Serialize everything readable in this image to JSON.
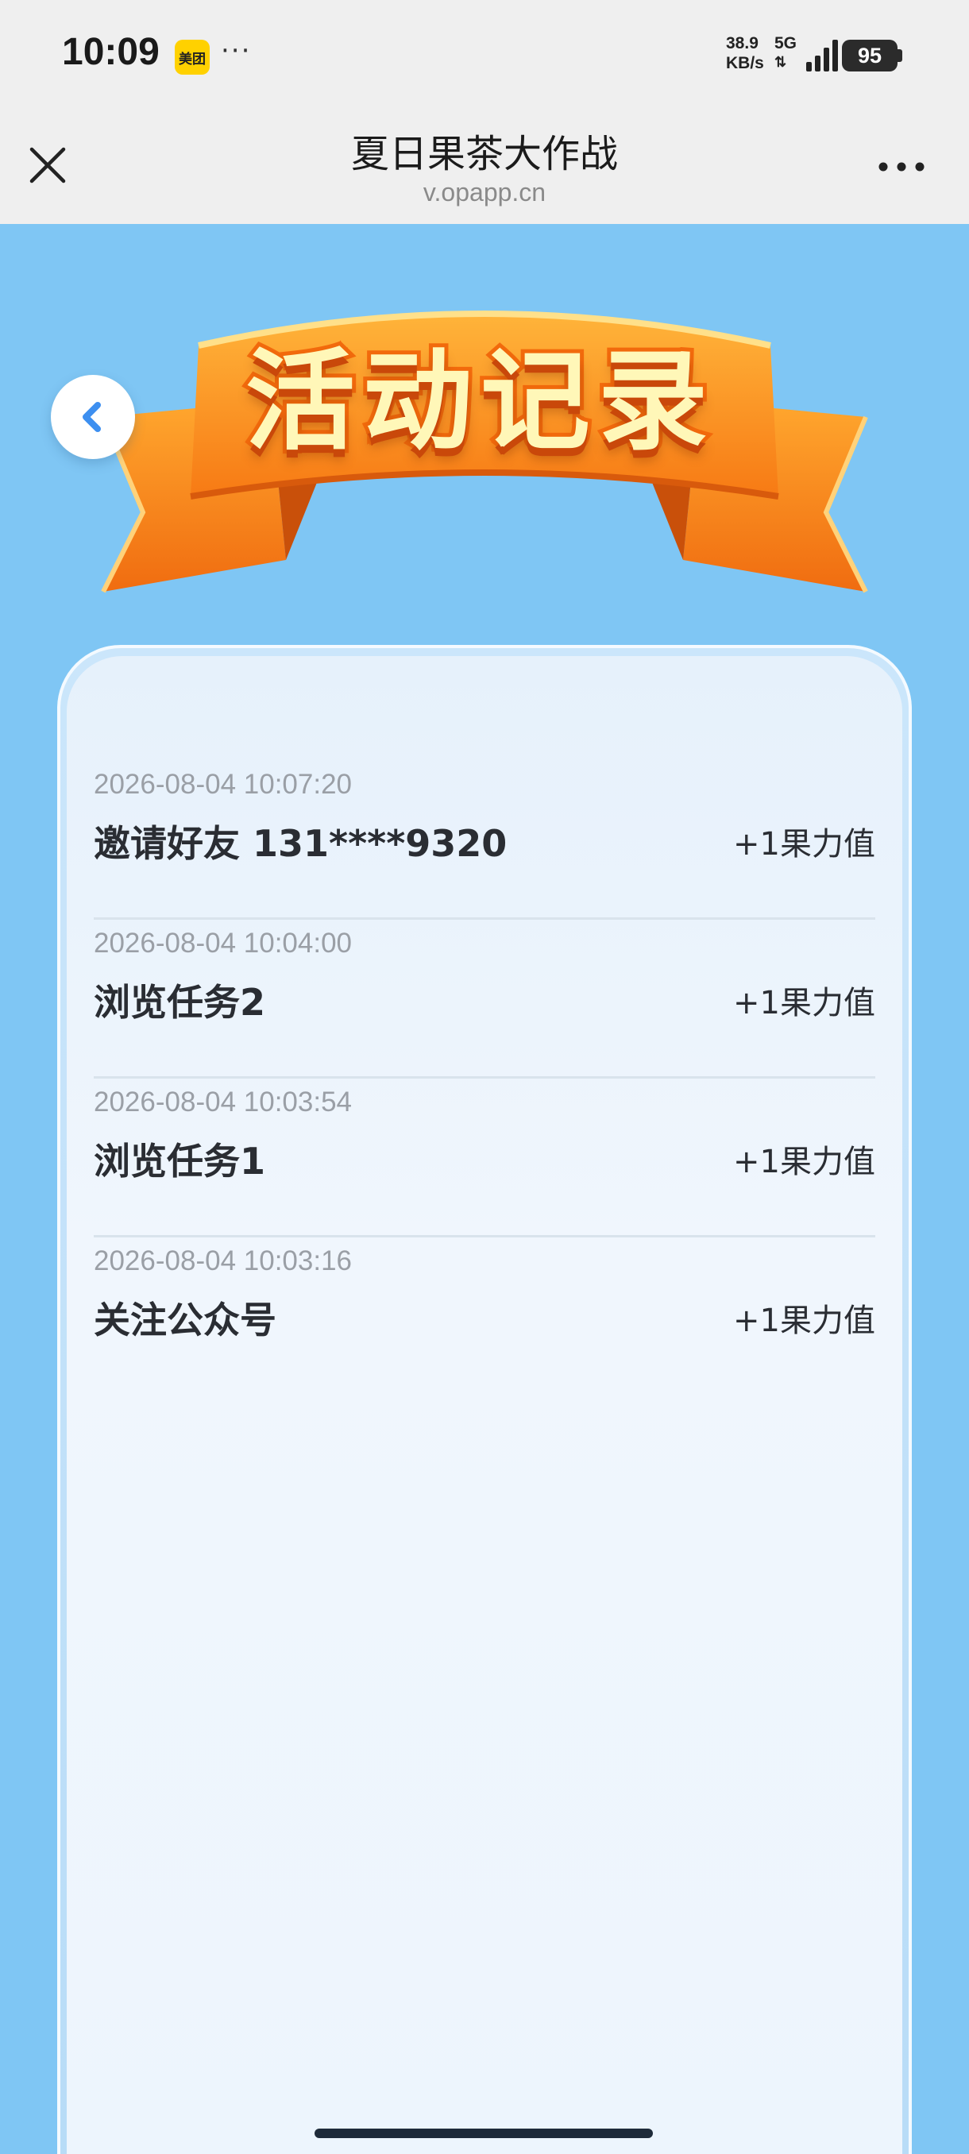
{
  "status_bar": {
    "time": "10:09",
    "app_badge": "美团",
    "more_dots": "···",
    "net_speed_value": "38.9",
    "net_speed_unit": "KB/s",
    "network": "5G",
    "battery": "95"
  },
  "title_bar": {
    "title": "夏日果茶大作战",
    "url": "v.opapp.cn"
  },
  "banner": {
    "title": "活动记录"
  },
  "records": [
    {
      "time": "2026-08-04 10:07:20",
      "title": "邀请好友 131****9320",
      "reward": "+1果力值"
    },
    {
      "time": "2026-08-04 10:04:00",
      "title": "浏览任务2",
      "reward": "+1果力值"
    },
    {
      "time": "2026-08-04 10:03:54",
      "title": "浏览任务1",
      "reward": "+1果力值"
    },
    {
      "time": "2026-08-04 10:03:16",
      "title": "关注公众号",
      "reward": "+1果力值"
    }
  ],
  "colors": {
    "page_background": "#7fc6f4",
    "banner_orange": "#f26a0c",
    "accent_blue": "#3d8ff0"
  }
}
